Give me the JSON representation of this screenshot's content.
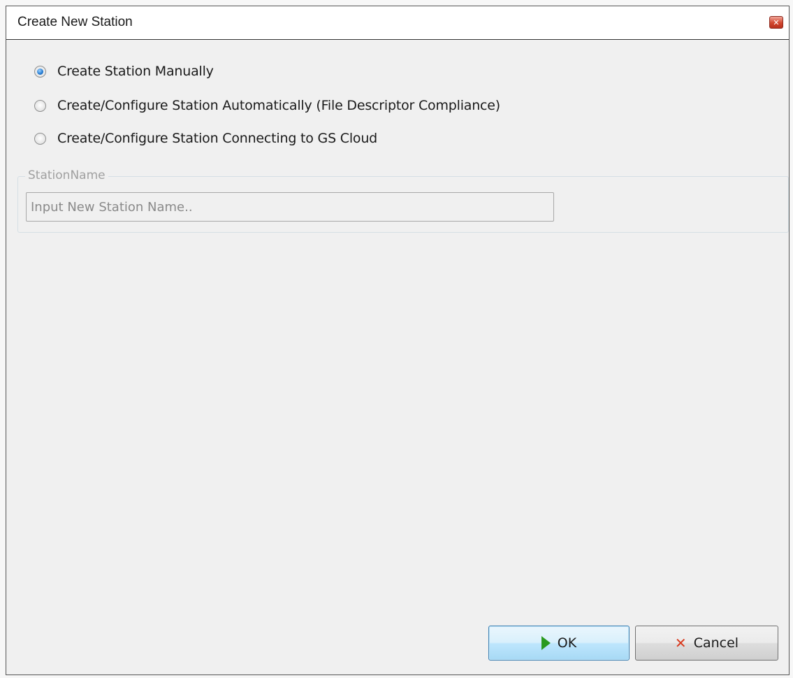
{
  "window": {
    "title": "Create New Station",
    "close_glyph": "✕"
  },
  "options": [
    {
      "label": "Create Station Manually",
      "checked": true
    },
    {
      "label": "Create/Configure Station Automatically (File Descriptor Compliance)",
      "checked": false
    },
    {
      "label": "Create/Configure Station Connecting to GS Cloud",
      "checked": false
    }
  ],
  "station_group": {
    "legend": "StationName",
    "placeholder": "Input New Station Name..",
    "value": ""
  },
  "buttons": {
    "ok_label": "OK",
    "cancel_label": "Cancel",
    "ok_icon": "play-arrow-icon",
    "cancel_icon": "x-icon"
  },
  "colors": {
    "dialog_bg": "#f0f0f0",
    "ok_icon": "#2a9a1e",
    "cancel_icon": "#d93a1e",
    "radio_checked": "#2a7fd4"
  }
}
